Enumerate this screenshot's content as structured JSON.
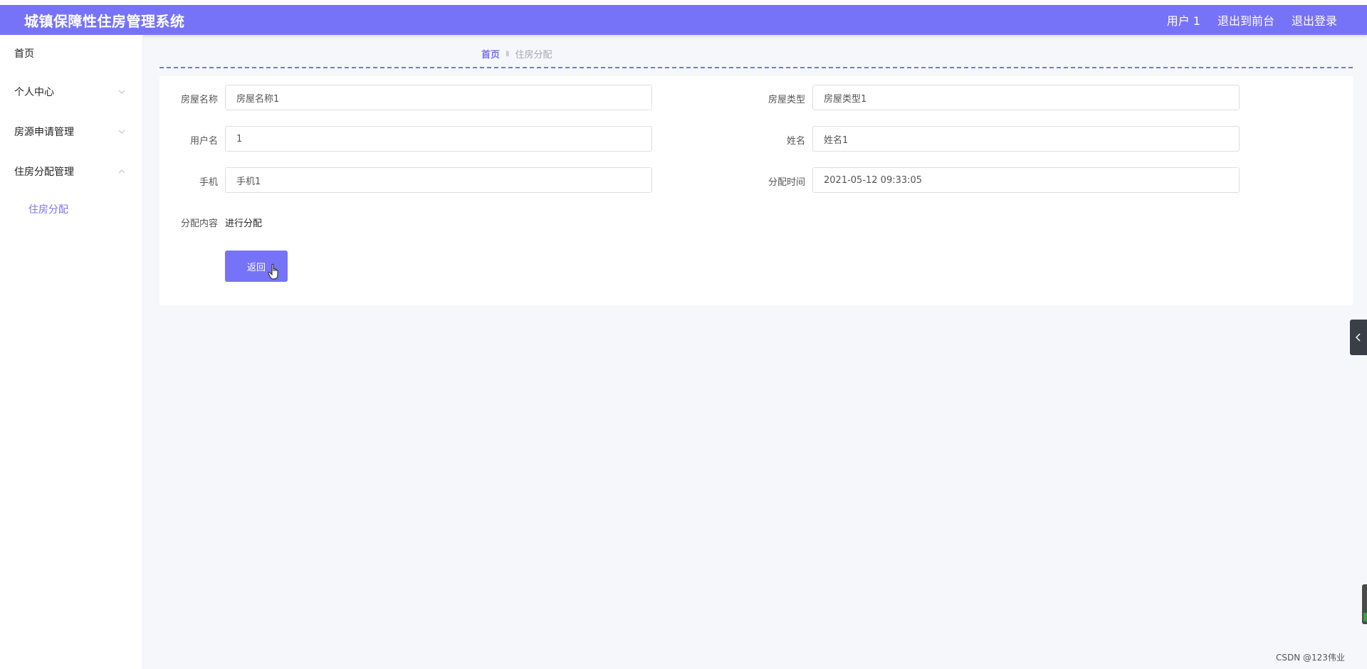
{
  "header": {
    "app_title": "城镇保障性住房管理系统",
    "user": "用户 1",
    "exit_front": "退出到前台",
    "logout": "退出登录"
  },
  "sidebar": {
    "items": [
      {
        "label": "首页"
      },
      {
        "label": "个人中心"
      },
      {
        "label": "房源申请管理"
      },
      {
        "label": "住房分配管理"
      }
    ],
    "subitem": "住房分配"
  },
  "breadcrumb": {
    "home": "首页",
    "current": "住房分配"
  },
  "form": {
    "house_name_label": "房屋名称",
    "house_name_value": "房屋名称1",
    "house_type_label": "房屋类型",
    "house_type_value": "房屋类型1",
    "username_label": "用户名",
    "username_value": "1",
    "name_label": "姓名",
    "name_value": "姓名1",
    "phone_label": "手机",
    "phone_value": "手机1",
    "assign_time_label": "分配时间",
    "assign_time_value": "2021-05-12 09:33:05",
    "content_label": "分配内容",
    "content_value": "进行分配",
    "back_button": "返回"
  },
  "watermark": "CSDN @123伟业",
  "colors": {
    "primary": "#7773f8",
    "background": "#f5f7fb"
  }
}
